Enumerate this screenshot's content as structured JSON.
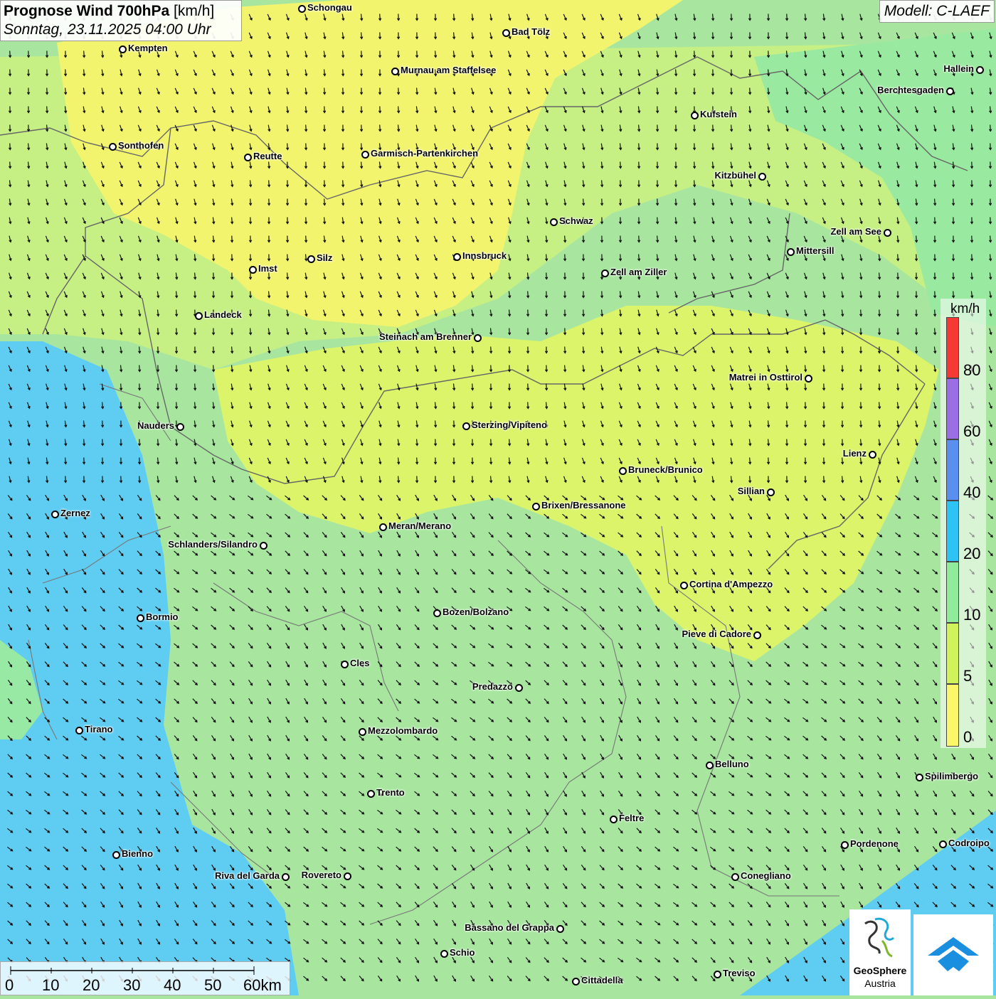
{
  "title": {
    "main": "Prognose Wind 700hPa",
    "unit": "[km/h]",
    "datetime": "Sonntag, 23.11.2025 04:00 Uhr"
  },
  "model": "Modell: C-LAEF",
  "legend": {
    "unit": "km/h",
    "labels": [
      "80",
      "60",
      "40",
      "20",
      "10",
      "5",
      "0"
    ],
    "colors": [
      "#f53a36",
      "#9b6ee6",
      "#5a8ff0",
      "#2ec3f5",
      "#90ec9c",
      "#d0f25a",
      "#fbf66a"
    ]
  },
  "scale": {
    "labels": [
      "0",
      "10",
      "20",
      "30",
      "40",
      "50",
      "60km"
    ]
  },
  "wind_field": {
    "direction": "from north-west",
    "dominant_colors": [
      "#fbf66a",
      "#d0f25a",
      "#a8e6a0",
      "#90ec9c",
      "#5fd0f0"
    ]
  },
  "logos": {
    "geosphere_line1": "GeoSphere",
    "geosphere_line2": "Austria"
  },
  "cities": [
    {
      "name": "Schongau"
    },
    {
      "name": "Bad Tölz"
    },
    {
      "name": "Kempten"
    },
    {
      "name": "Murnau am Staffelsee"
    },
    {
      "name": "Hallein"
    },
    {
      "name": "Berchtesgaden"
    },
    {
      "name": "Kufstein"
    },
    {
      "name": "Sonthofen"
    },
    {
      "name": "Reutte"
    },
    {
      "name": "Garmisch-Partenkirchen"
    },
    {
      "name": "Kitzbühel"
    },
    {
      "name": "Schwaz"
    },
    {
      "name": "Zell am See"
    },
    {
      "name": "Mittersill"
    },
    {
      "name": "Silz"
    },
    {
      "name": "Innsbruck"
    },
    {
      "name": "Imst"
    },
    {
      "name": "Zell am Ziller"
    },
    {
      "name": "Landeck"
    },
    {
      "name": "Steinach am Brenner"
    },
    {
      "name": "Matrei in Osttirol"
    },
    {
      "name": "Nauders"
    },
    {
      "name": "Sterzing/Vipiteno"
    },
    {
      "name": "Lienz"
    },
    {
      "name": "Bruneck/Brunico"
    },
    {
      "name": "Sillian"
    },
    {
      "name": "Brixen/Bressanone"
    },
    {
      "name": "Zernez"
    },
    {
      "name": "Meran/Merano"
    },
    {
      "name": "Schlanders/Silandro"
    },
    {
      "name": "Cortina d'Ampezzo"
    },
    {
      "name": "Bozen/Bolzano"
    },
    {
      "name": "Bormio"
    },
    {
      "name": "Pieve di Cadore"
    },
    {
      "name": "Cles"
    },
    {
      "name": "Predazzo"
    },
    {
      "name": "Tirano"
    },
    {
      "name": "Mezzolombardo"
    },
    {
      "name": "Belluno"
    },
    {
      "name": "Spilimbergo"
    },
    {
      "name": "Trento"
    },
    {
      "name": "Feltre"
    },
    {
      "name": "Pordenone"
    },
    {
      "name": "Codroipo"
    },
    {
      "name": "Bienno"
    },
    {
      "name": "Riva del Garda"
    },
    {
      "name": "Rovereto"
    },
    {
      "name": "Conegliano"
    },
    {
      "name": "Bassano del Grappa"
    },
    {
      "name": "Schio"
    },
    {
      "name": "Treviso"
    },
    {
      "name": "Cittadella"
    }
  ]
}
